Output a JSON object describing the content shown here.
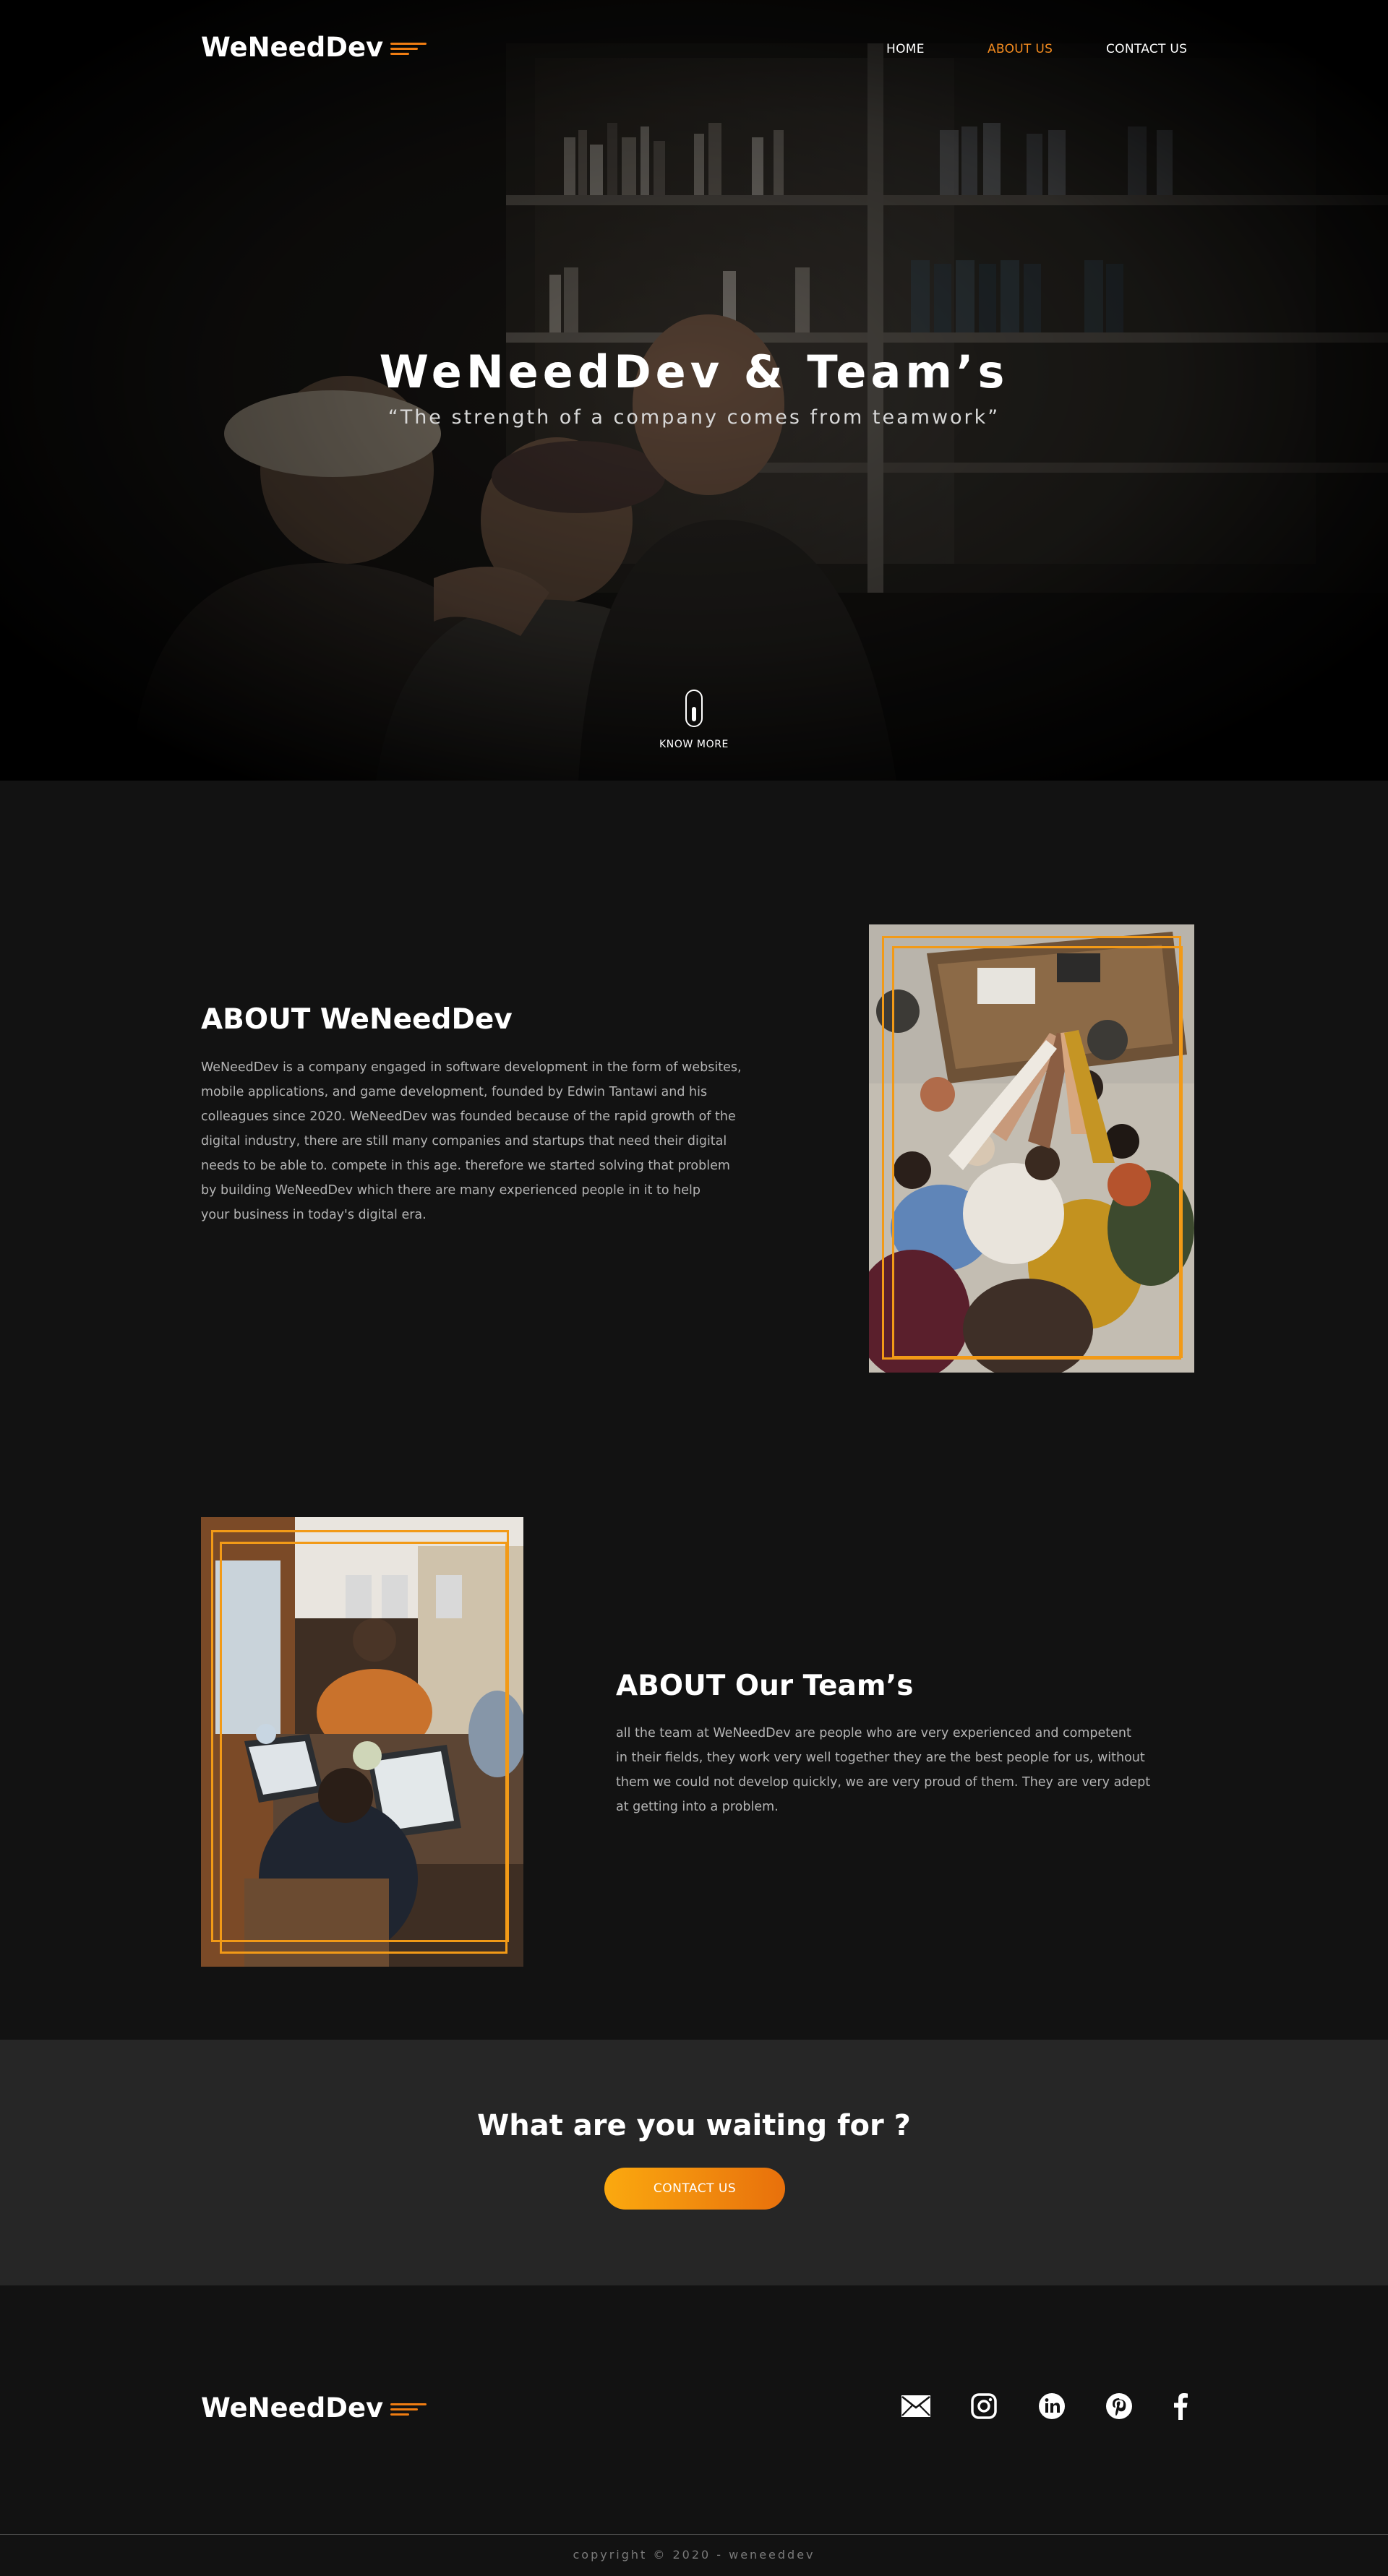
{
  "brand": {
    "name": "WeNeedDev",
    "accent": "#f07d12"
  },
  "nav": {
    "items": [
      {
        "label": "HOME",
        "active": false
      },
      {
        "label": "ABOUT US",
        "active": true
      },
      {
        "label": "CONTACT US",
        "active": false
      }
    ]
  },
  "hero": {
    "title": "WeNeedDev & Team’s",
    "subtitle": "“The strength of a company comes from teamwork”",
    "scroll_label": "KNOW MORE"
  },
  "about_company": {
    "title": "ABOUT WeNeedDev",
    "lines": [
      "WeNeedDev is a company engaged in software development in the form of websites,",
      "mobile applications, and game development, founded by Edwin Tantawi and his",
      "colleagues since 2020. WeNeedDev was founded because of the rapid growth of the",
      "digital industry, there are still many companies and startups that need their digital",
      "needs to be able to. compete in this age. therefore we started solving that problem",
      "by building WeNeedDev which there are many experienced people in it to help",
      "your business in today's digital era."
    ]
  },
  "about_team": {
    "title": "ABOUT Our Team’s",
    "lines": [
      "all the team at WeNeedDev are people who are very experienced and competent",
      "in their fields, they work very well together they are the best people for us, without",
      "them we could not develop quickly, we are very proud of them. They are very adept",
      "at getting into a problem."
    ]
  },
  "cta": {
    "title": "What are you waiting for ?",
    "button_label": "CONTACT US",
    "gradient": [
      "#fba90f",
      "#e8700c"
    ]
  },
  "footer": {
    "social_icons": [
      "mail-icon",
      "instagram-icon",
      "linkedin-icon",
      "pinterest-icon",
      "facebook-icon"
    ],
    "copyright": "copyright © 2020 - weneeddev"
  }
}
